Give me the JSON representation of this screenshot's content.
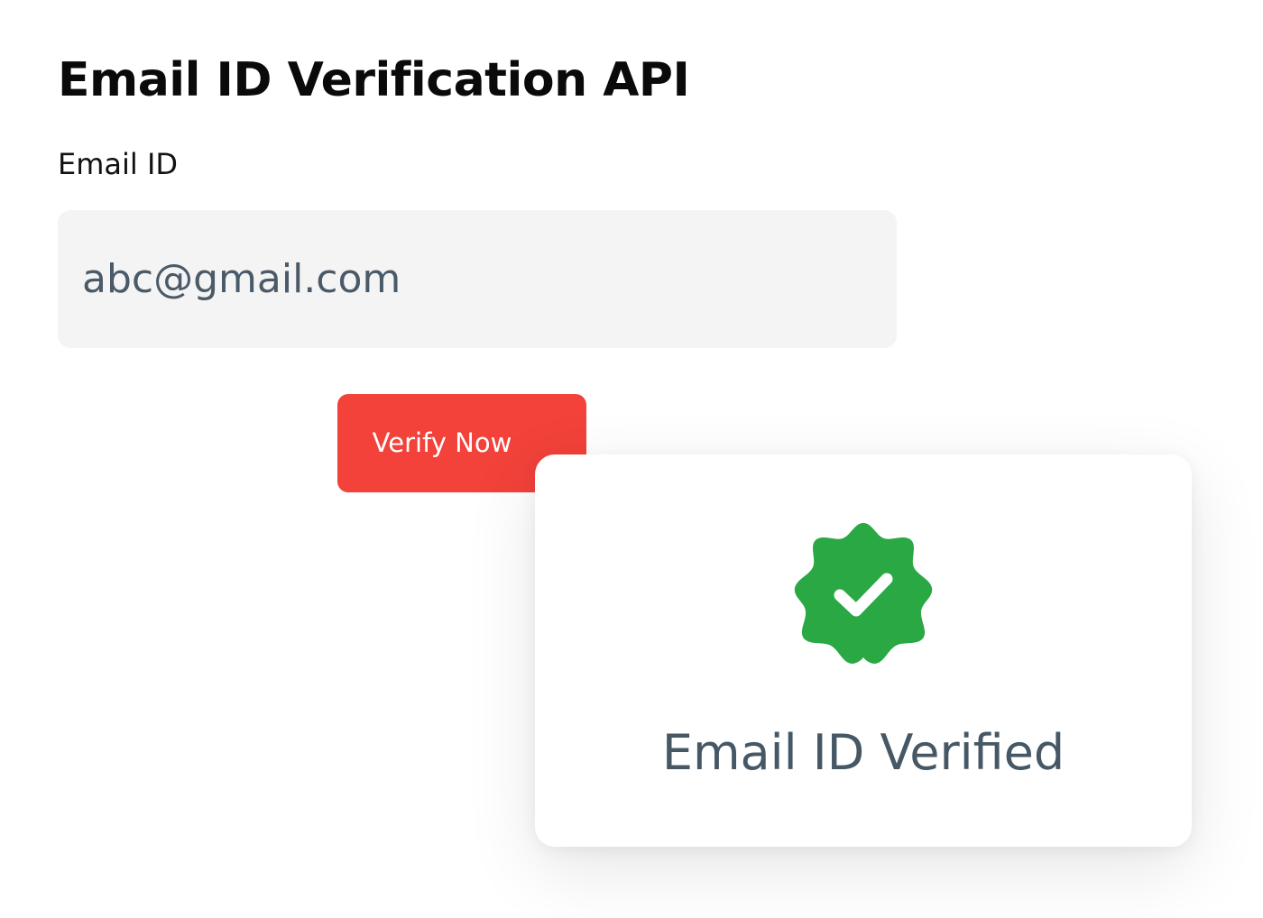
{
  "header": {
    "title": "Email ID Verification API"
  },
  "form": {
    "email_label": "Email ID",
    "email_value": "abc@gmail.com",
    "verify_label": "Verify Now"
  },
  "result": {
    "icon": "verified-badge-check-icon",
    "message": "Email ID Verified"
  },
  "colors": {
    "button": "#f2423a",
    "badge": "#2aa844",
    "input_background": "#f4f4f4",
    "result_text": "#465866"
  }
}
